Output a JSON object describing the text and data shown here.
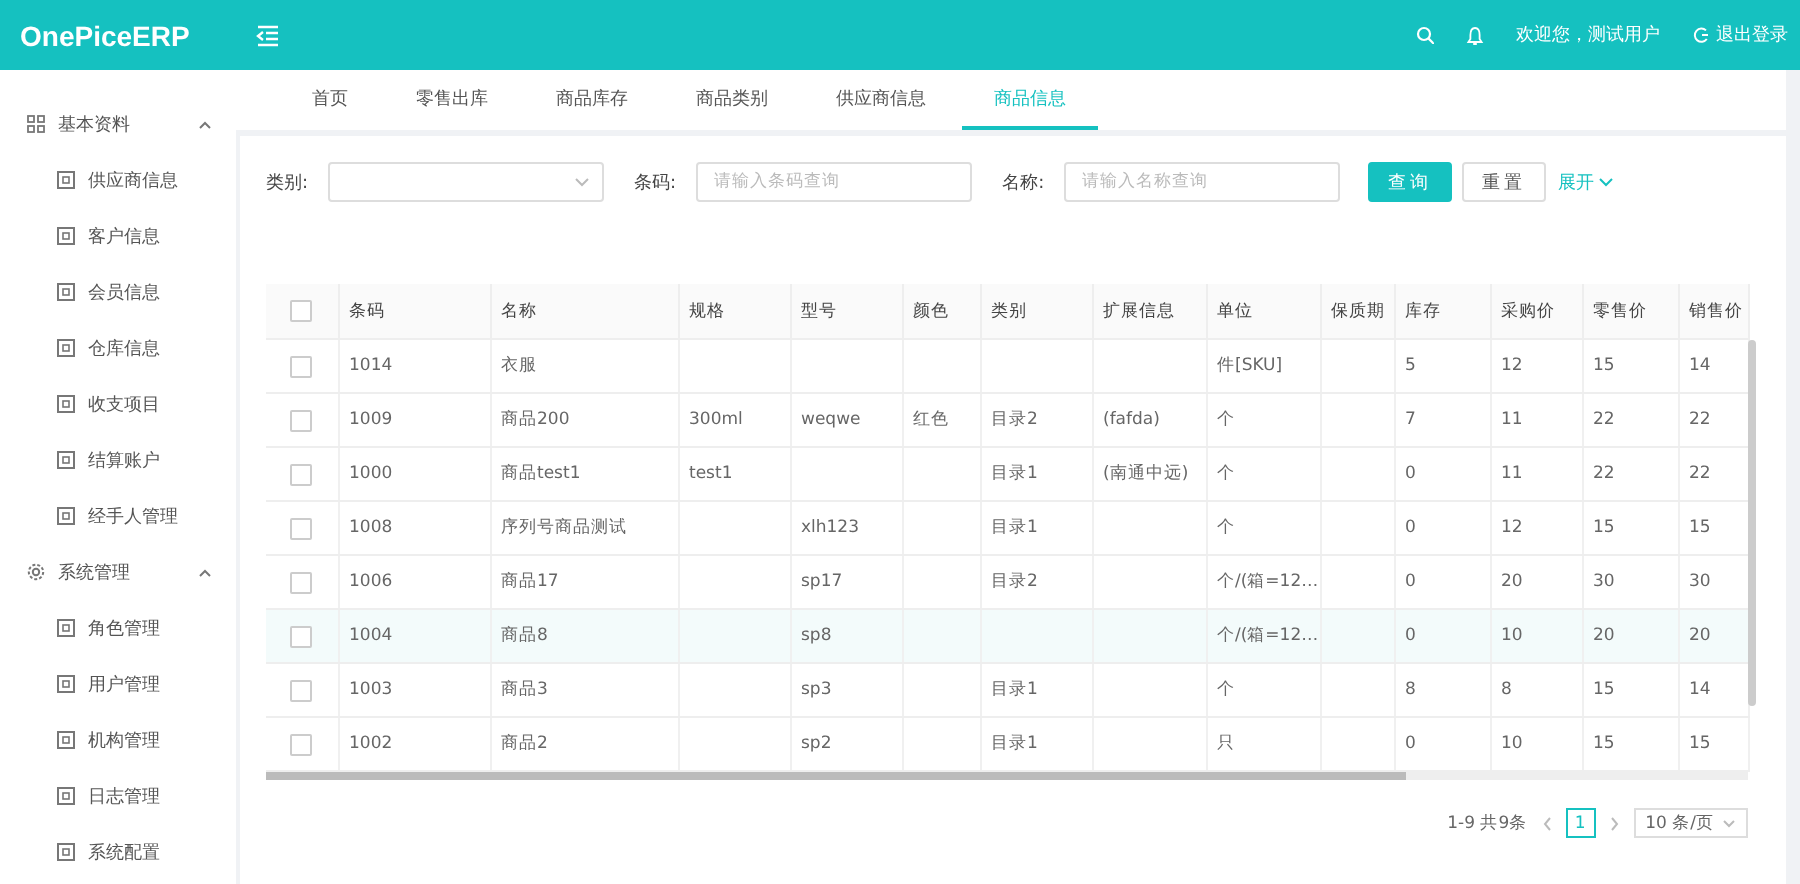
{
  "header": {
    "logo": "OnePiceERP",
    "greeting": "欢迎您，测试用户",
    "logout": "退出登录"
  },
  "sidebar": {
    "groups": [
      {
        "label": "基本资料",
        "kind": "grid",
        "expanded": true,
        "children": [
          "供应商信息",
          "客户信息",
          "会员信息",
          "仓库信息",
          "收支项目",
          "结算账户",
          "经手人管理"
        ]
      },
      {
        "label": "系统管理",
        "kind": "gear",
        "expanded": true,
        "children": [
          "角色管理",
          "用户管理",
          "机构管理",
          "日志管理",
          "系统配置"
        ]
      }
    ]
  },
  "tabs": [
    {
      "label": "首页",
      "selected": false
    },
    {
      "label": "零售出库",
      "selected": false
    },
    {
      "label": "商品库存",
      "selected": false
    },
    {
      "label": "商品类别",
      "selected": false
    },
    {
      "label": "供应商信息",
      "selected": false
    },
    {
      "label": "商品信息",
      "selected": true
    }
  ],
  "filters": {
    "fields": [
      {
        "label": "类别:",
        "kind": "select"
      },
      {
        "label": "条码:",
        "kind": "input",
        "placeholder": "请输入条码查询"
      },
      {
        "label": "名称:",
        "kind": "input",
        "placeholder": "请输入名称查询"
      }
    ],
    "buttons": [
      {
        "label": "查询",
        "kind": "primary"
      },
      {
        "label": "重置",
        "kind": "default"
      }
    ],
    "expand": "展开"
  },
  "table": {
    "header_checked": false,
    "columns": [
      "条码",
      "名称",
      "规格",
      "型号",
      "颜色",
      "类别",
      "扩展信息",
      "单位",
      "保质期",
      "库存",
      "采购价",
      "零售价",
      "销售价"
    ],
    "rows": [
      {
        "checked": false,
        "hovered": false,
        "cells": [
          "1014",
          "衣服",
          null,
          null,
          null,
          null,
          null,
          "件[SKU]",
          null,
          "5",
          "12",
          "15",
          "14"
        ]
      },
      {
        "checked": false,
        "hovered": false,
        "cells": [
          "1009",
          "商品200",
          "300ml",
          "weqwe",
          "红色",
          "目录2",
          "(fafda)",
          "个",
          null,
          "7",
          "11",
          "22",
          "22"
        ]
      },
      {
        "checked": false,
        "hovered": false,
        "cells": [
          "1000",
          "商品test1",
          "test1",
          null,
          null,
          "目录1",
          "(南通中远)",
          "个",
          null,
          "0",
          "11",
          "22",
          "22"
        ]
      },
      {
        "checked": false,
        "hovered": false,
        "cells": [
          "1008",
          "序列号商品测试",
          null,
          "xlh123",
          null,
          "目录1",
          null,
          "个",
          null,
          "0",
          "12",
          "15",
          "15"
        ]
      },
      {
        "checked": false,
        "hovered": false,
        "cells": [
          "1006",
          "商品17",
          null,
          "sp17",
          null,
          "目录2",
          null,
          "个/(箱=12…",
          null,
          "0",
          "20",
          "30",
          "30"
        ]
      },
      {
        "checked": false,
        "hovered": true,
        "cells": [
          "1004",
          "商品8",
          null,
          "sp8",
          null,
          null,
          null,
          "个/(箱=12…",
          null,
          "0",
          "10",
          "20",
          "20"
        ]
      },
      {
        "checked": false,
        "hovered": false,
        "cells": [
          "1003",
          "商品3",
          null,
          "sp3",
          null,
          "目录1",
          null,
          "个",
          null,
          "8",
          "8",
          "15",
          "14"
        ]
      },
      {
        "checked": false,
        "hovered": false,
        "cells": [
          "1002",
          "商品2",
          null,
          "sp2",
          null,
          "目录1",
          null,
          "只",
          null,
          "0",
          "10",
          "15",
          "15"
        ]
      }
    ]
  },
  "pagination": {
    "summary": "1-9 共9条",
    "pages": [
      {
        "label": "1",
        "selected": true
      }
    ],
    "page_size": "10 条/页"
  }
}
